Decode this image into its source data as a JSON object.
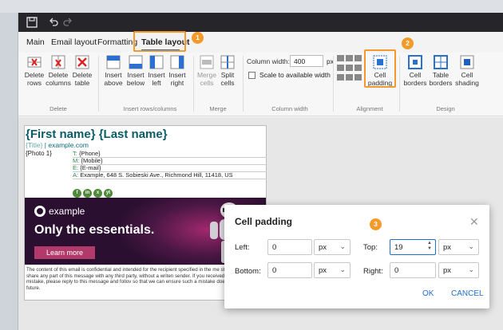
{
  "tabs": [
    "Main",
    "Email layout",
    "Formatting",
    "Table layout"
  ],
  "ribbon": {
    "delete_rows": "Delete rows",
    "delete_columns": "Delete columns",
    "delete_table": "Delete table",
    "insert_above": "Insert above",
    "insert_below": "Insert below",
    "insert_left": "Insert left",
    "insert_right": "Insert right",
    "merge_cells": "Merge cells",
    "split_cells": "Split cells",
    "column_width_label": "Column width:",
    "column_width_value": "400",
    "column_width_unit": "px",
    "scale_label": "Scale to available width",
    "cell_padding": "Cell padding",
    "cell_borders": "Cell borders",
    "table_borders": "Table borders",
    "cell_shading": "Cell shading",
    "groups": {
      "delete": "Delete",
      "insert": "Insert rows/columns",
      "merge": "Merge",
      "column_width": "Column width",
      "alignment": "Alignment",
      "design": "Design"
    }
  },
  "signature": {
    "full_name": "{First name} {Last name}",
    "title_placeholder": "{Title}",
    "title_sep": " | ",
    "website": "example.com",
    "photo": "{Photo 1}",
    "contacts": [
      {
        "key": "T:",
        "value": "{Phone}"
      },
      {
        "key": "M:",
        "value": "{Mobile}"
      },
      {
        "key": "E:",
        "value": "{E-mail}"
      },
      {
        "key": "A:",
        "value": "Example, 648 S. Sobieski Ave., Richmond Hill, 11418, US"
      }
    ],
    "social": [
      "f",
      "in",
      "x",
      "yt"
    ],
    "banner": {
      "brand": "example",
      "headline": "Only the essentials.",
      "cta": "Learn more"
    },
    "disclaimer": "The content of this email is confidential and intended for the recipient specified in the me strictly forbidden to share any part of this message with any third party, without a writen sender. If you received this message by mistake, please reply to this message and follov so that we can ensure such a mistake does not occur in the future."
  },
  "dialog": {
    "title": "Cell padding",
    "left_label": "Left:",
    "left_value": "0",
    "left_unit": "px",
    "top_label": "Top:",
    "top_value": "19",
    "top_unit": "px",
    "bottom_label": "Bottom:",
    "bottom_value": "0",
    "bottom_unit": "px",
    "right_label": "Right:",
    "right_value": "0",
    "right_unit": "px",
    "ok": "OK",
    "cancel": "CANCEL"
  },
  "callouts": [
    "1",
    "2",
    "3"
  ],
  "colors": {
    "accent": "#1f6fd1",
    "callout": "#f39a2a",
    "brand_teal": "#0a5c66"
  }
}
